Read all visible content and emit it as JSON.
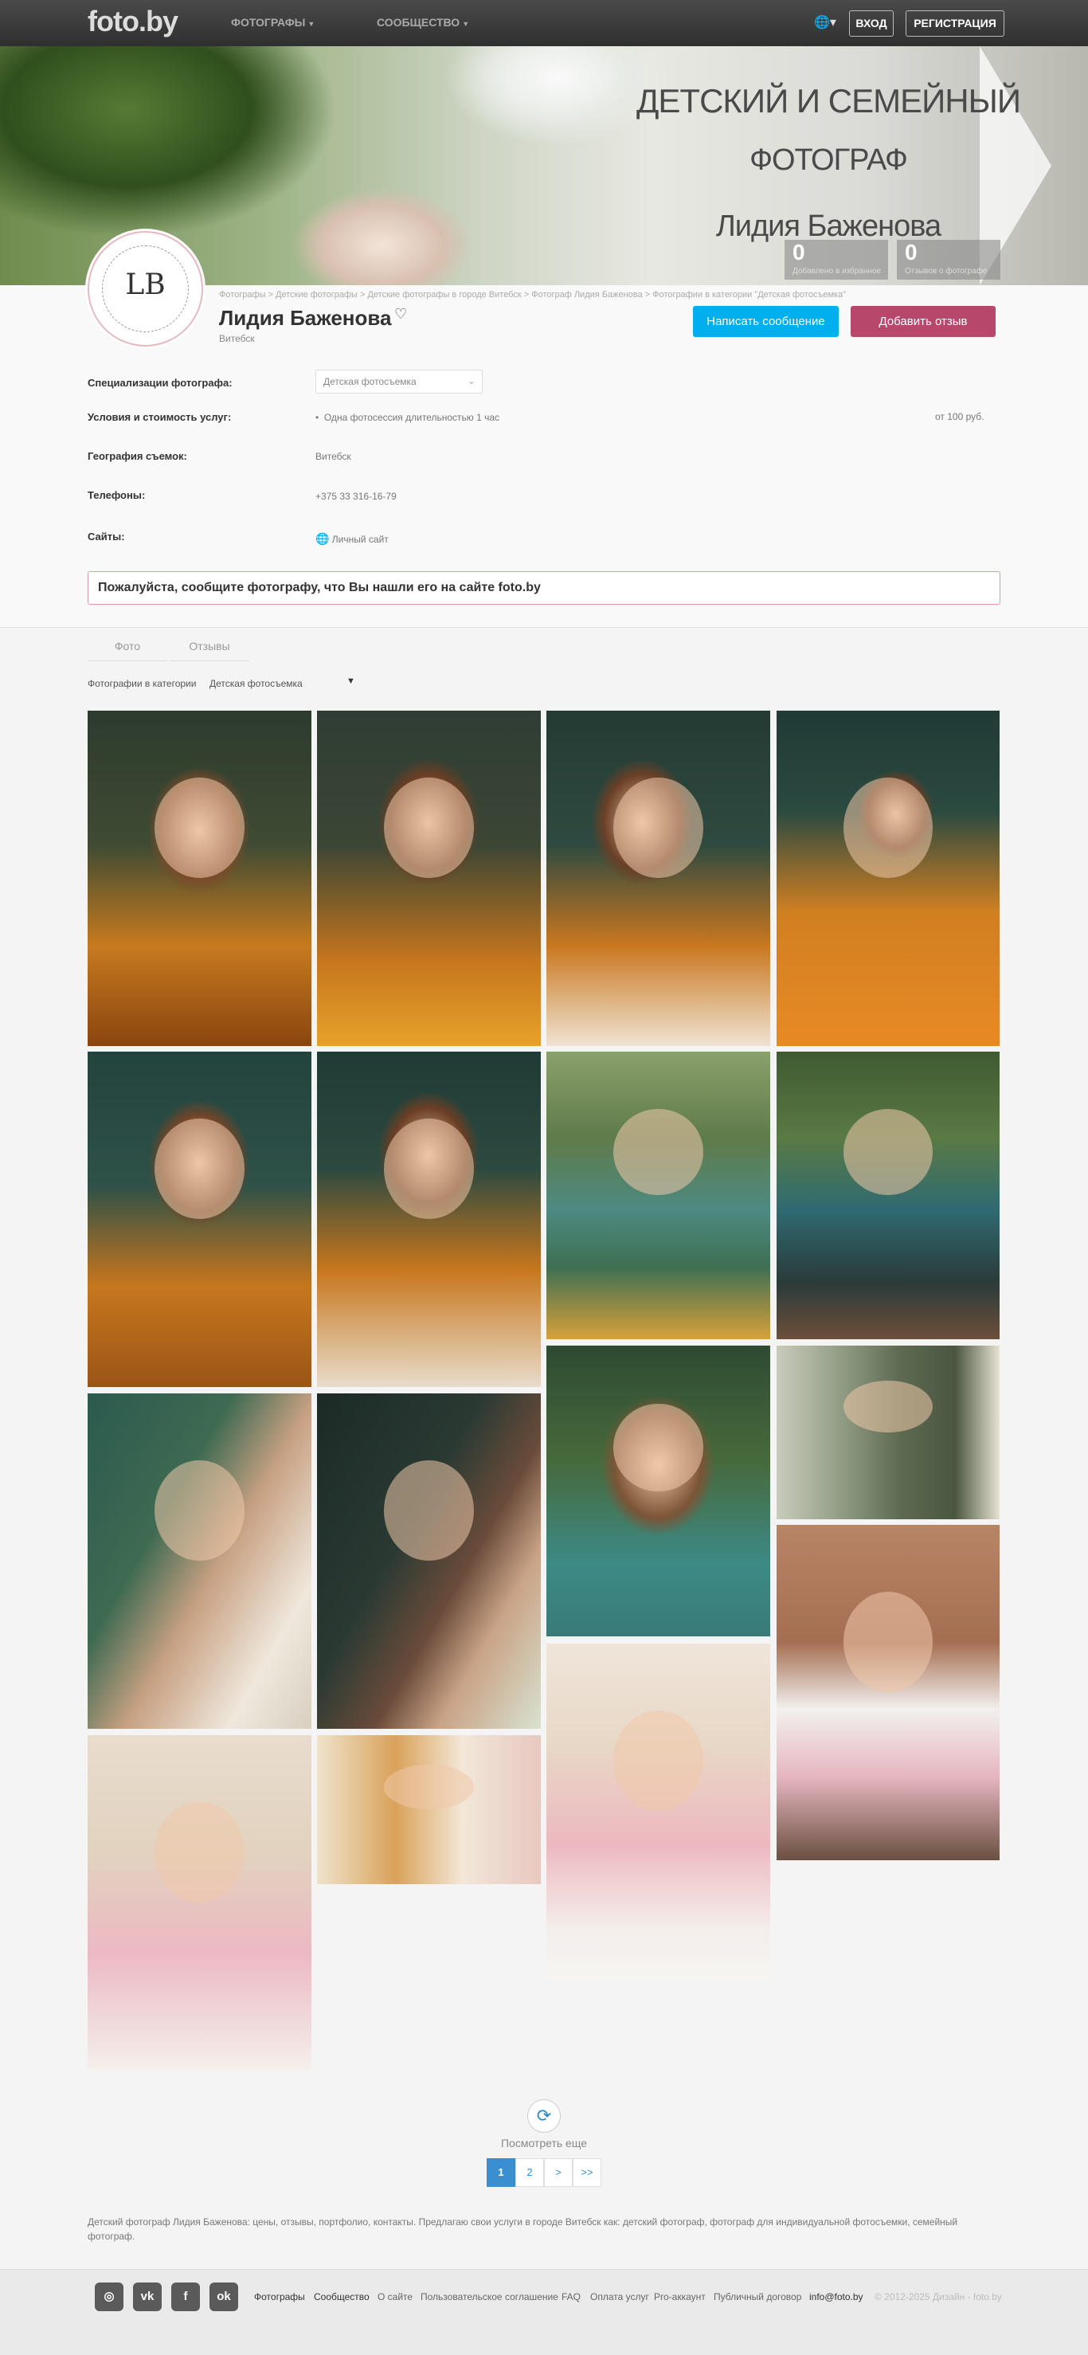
{
  "nav": {
    "logo": "foto.by",
    "photos": "ФОТОГРАФЫ",
    "community": "СООБЩЕСТВО",
    "login": "ВХОД",
    "register": "РЕГИСТРАЦИЯ"
  },
  "banner": {
    "line1": "ДЕТСКИЙ И СЕМЕЙНЫЙ",
    "line2": "ФОТОГРАФ",
    "line3": "Лидия Баженова",
    "stat1_num": "0",
    "stat1_label": "Добавлено в избранное",
    "stat2_num": "0",
    "stat2_label": "Отзывов о фотографе"
  },
  "avatar": {
    "monogram": "LB"
  },
  "breadcrumb": "Фотографы > Детские фотографы > Детские фотографы в городе Витебск > Фотограф Лидия Баженова > Фотографии в категории \"Детская фотосъемка\"",
  "profile": {
    "name": "Лидия Баженова",
    "city": "Витебск",
    "send_message": "Написать сообщение",
    "add_review": "Добавить отзыв"
  },
  "info": {
    "spec_label": "Специализации фотографа:",
    "spec_value": "Детская фотосъемка",
    "terms_label": "Условия и стоимость услуг:",
    "terms_value": "Одна фотосессия длительностью 1 час",
    "terms_price": "от 100 руб.",
    "geo_label": "География съемок:",
    "geo_value": "Витебск",
    "phones_label": "Телефоны:",
    "phones_value": "+375 33 316-16-79",
    "sites_label": "Сайты:",
    "sites_value": "Личный сайт"
  },
  "notice": "Пожалуйста, сообщите фотографу, что Вы нашли его на сайте foto.by",
  "tabs": {
    "photo": "Фото",
    "reviews": "Отзывы"
  },
  "filter": {
    "label": "Фотографии в категории",
    "value": "Детская фотосъемка"
  },
  "more": {
    "label": "Посмотреть еще"
  },
  "pagination": [
    "1",
    "2",
    ">",
    ">>"
  ],
  "seo_text": "Детский фотограф Лидия Баженова: цены, отзывы, портфолио, контакты. Предлагаю свои услуги в городе Витебск как: детский фотограф, фотограф для индивидуальной фотосъемки, семейный фотограф.",
  "footer": {
    "links": [
      "Фотографы",
      "Сообщество",
      "О сайте",
      "Пользовательское соглашение",
      "FAQ",
      "Оплата услуг",
      "Pro-аккаунт",
      "Публичный договор",
      "info@foto.by"
    ],
    "copyright": "© 2012-2025 Дизайн - foto.by"
  },
  "colors": {
    "accent_blue": "#00b0ee",
    "accent_rose": "#b7486c",
    "page_active": "#3a8fd0"
  }
}
